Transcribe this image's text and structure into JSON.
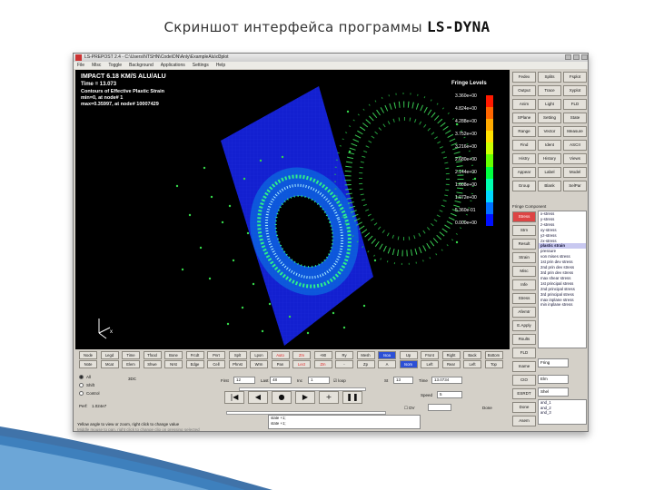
{
  "slide": {
    "title_prefix": "Скриншот интерфейса программы ",
    "title_product": "LS-DYNA"
  },
  "window": {
    "title": "LS-PREPOST 2.4 - C:\\Users\\NTSHN\\Code\\DN\\Anly\\ExampleAlu\\d3plot",
    "menu": [
      "File",
      "Misc",
      "Toggle",
      "Background",
      "Applications",
      "Settings",
      "Help"
    ]
  },
  "viewport": {
    "header": [
      "IMPACT 6.18 KM/S ALU/ALU",
      "Time  =      13.073"
    ],
    "caption": [
      "Contours of Effective Plastic Strain",
      "min=0, at node# 1",
      "max=0.35997, at node# 10007429"
    ],
    "fringe_title": "Fringe Levels",
    "fringe_labels": [
      "3.360e+00",
      "4.824e+00",
      "4.288e+00",
      "3.752e+00",
      "3.216e+00",
      "2.680e+00",
      "2.144e+00",
      "1.608e+00",
      "1.072e+00",
      "5.360e-01",
      "0.000e+00"
    ],
    "fringe_colors": [
      "#ff1a00",
      "#ff6600",
      "#ffaa00",
      "#ffe000",
      "#ccff00",
      "#66ff00",
      "#00ff40",
      "#00ffb0",
      "#00d8ff",
      "#0070ff",
      "#0010ff"
    ]
  },
  "right_panel": {
    "grid": [
      [
        "Fedex",
        "Splits",
        "Fsplot"
      ],
      [
        "Output",
        "Trace",
        "Xyplot"
      ],
      [
        "Anim",
        "Light",
        "FLD"
      ],
      [
        "SPlane",
        "Setting",
        "State"
      ],
      [
        "Range",
        "Vector",
        "Measure"
      ],
      [
        "Find",
        "Ident",
        "ASCII"
      ],
      [
        "Histry",
        "History",
        "Views"
      ],
      [
        "Appear",
        "Label",
        "Model"
      ],
      [
        "Group",
        "Blank",
        "SelPar"
      ]
    ],
    "fringe_component_label": "Fringe Component",
    "side_buttons": [
      "Stress",
      "Strn",
      "Result",
      "Strain",
      "Misc",
      "Infe",
      "Stress",
      "Afemtr",
      "E.Apply",
      "Rsults",
      "FLD",
      "Iname",
      "CtO",
      "ESRDT",
      "Done",
      "Asem"
    ],
    "components": [
      "x-stress",
      "y-stress",
      "z-stress",
      "xy-stress",
      "yz-stress",
      "zx-stress",
      "plastic strain",
      "pressure",
      "von mises stress",
      "1st prin dev stress",
      "2nd prin dev stress",
      "3rd prin dev stress",
      "max shear stress",
      "1st principal stress",
      "2nd principal stress",
      "3rd principal stress",
      "max inplane stress",
      "min inplane stress"
    ],
    "selected_component": "plastic strain",
    "selects": [
      "Fring",
      "Elm",
      "Shel"
    ],
    "mini_list": [
      "and_1",
      "and_2",
      "and_3"
    ]
  },
  "button_row1": [
    "Node",
    "Legd",
    "Time",
    "Tfood",
    "Bone",
    "Frcdt",
    "Pnrt",
    "Splt",
    "Lpon",
    "Auto",
    "Zm",
    "+90",
    "Ry",
    "Mesh",
    "Isoa",
    "Up",
    "Front",
    "Right",
    "Back",
    "Bottom"
  ],
  "button_row2": [
    "Note",
    "Mcat",
    "Elem",
    "Shwe",
    "Nrst",
    "Edge",
    "Cell",
    "Phnst",
    "Wrm",
    "Pan",
    "Lect",
    "Zm",
    "-",
    "Zp",
    "A",
    "Isom",
    "Left",
    "Rear",
    "Left",
    "Top"
  ],
  "controls": {
    "radios": [
      "All",
      "Shift",
      "Control"
    ],
    "perf_label": "Perf:",
    "perf_value": "1.024e7",
    "dim_label": "3DC",
    "first_label": "First",
    "first_value": "12",
    "last_label": "Last",
    "last_value": "48",
    "inc_label": "Inc",
    "inc_value": "1",
    "loop_label": "loop",
    "st_label": "St",
    "st_value": "13",
    "time_label": "Time",
    "time_value": "13.0734",
    "speed_label": "Speed",
    "speed_value": "5",
    "dv_label": "DV",
    "done_label": "Done",
    "status_lines": [
      "Yellow angle to view or zoom, right click to change value",
      "Middle mouse to pan, right click to change clip on pressing selected"
    ],
    "cmd_lines": [
      "state +1;",
      "state +1;"
    ],
    "play_icons": [
      "|◀",
      "◀",
      "●",
      "▶",
      "+",
      "❚❚"
    ]
  }
}
